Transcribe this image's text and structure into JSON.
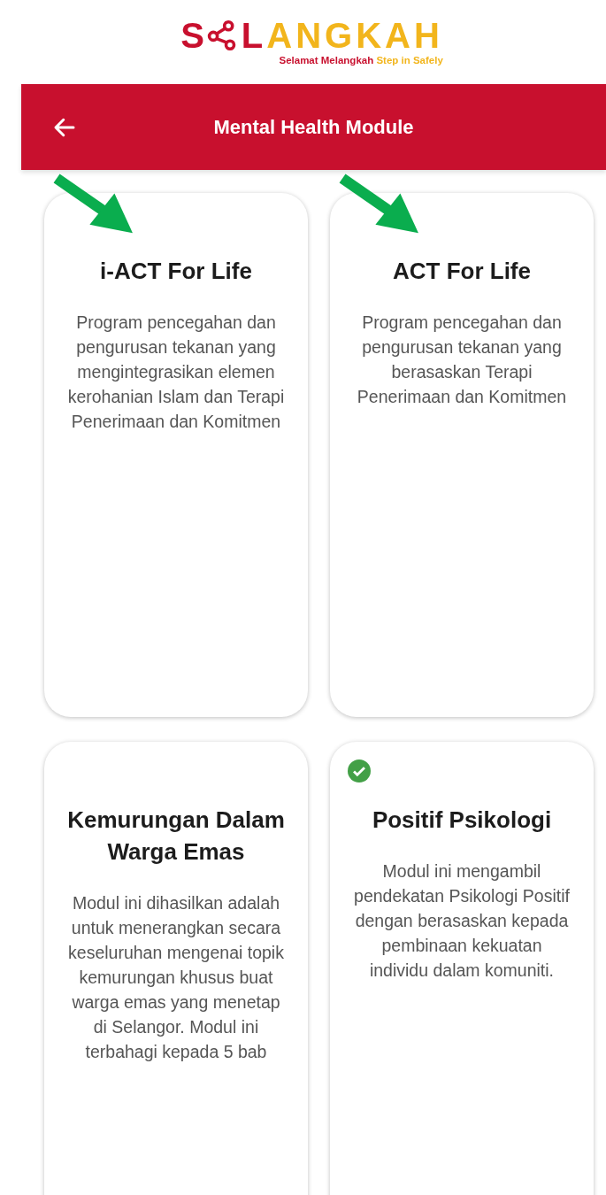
{
  "logo": {
    "lead": "S",
    "mark_letter": "L",
    "rest": "ANGKAH",
    "tagline_primary": "Selamat Melangkah",
    "tagline_secondary": "Step in Safely"
  },
  "app_bar": {
    "title": "Mental Health Module"
  },
  "modules": [
    {
      "title": "i-ACT For Life",
      "description": "Program pencegahan dan pengurusan tekanan yang mengintegrasikan elemen kerohanian Islam dan Terapi Penerimaan dan Komitmen",
      "completed": false,
      "pointed_at": true
    },
    {
      "title": "ACT For Life",
      "description": "Program pencegahan dan pengurusan tekanan yang berasaskan Terapi Penerimaan dan Komitmen",
      "completed": false,
      "pointed_at": true
    },
    {
      "title": "Kemurungan Dalam Warga Emas",
      "description": "Modul ini dihasilkan adalah untuk menerangkan secara keseluruhan mengenai topik kemurungan khusus buat warga emas yang menetap di Selangor. Modul ini terbahagi kepada 5 bab",
      "completed": false,
      "pointed_at": false
    },
    {
      "title": "Positif Psikologi",
      "description": "Modul ini mengambil pendekatan Psikologi Positif dengan berasaskan kepada pembinaan kekuatan individu dalam komuniti.",
      "completed": true,
      "pointed_at": false
    }
  ]
}
